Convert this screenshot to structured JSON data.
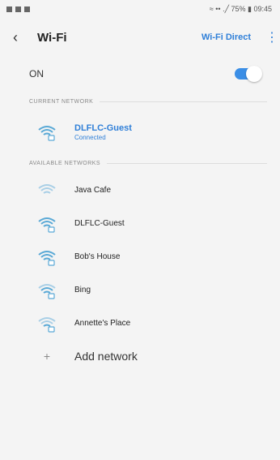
{
  "status_bar": {
    "right_text": "≈ •• .╱ 75% ▮ 09:45"
  },
  "header": {
    "back_icon": "chevron-left-icon",
    "title": "Wi-Fi",
    "wifi_direct": "Wi-Fi Direct",
    "more_icon": "more-vertical-icon"
  },
  "toggle": {
    "label": "ON",
    "state": "on",
    "accent": "#3a8ee6"
  },
  "current": {
    "section_label": "CURRENT NETWORK",
    "network": {
      "name": "DLFLC-Guest",
      "status": "Connected",
      "icon": "wifi-locked-icon"
    }
  },
  "available": {
    "section_label": "AVAILABLE NETWORKS",
    "networks": [
      {
        "name": "Java Cafe",
        "icon": "wifi-open-icon"
      },
      {
        "name": "DLFLC-Guest",
        "icon": "wifi-locked-icon"
      },
      {
        "name": "Bob's House",
        "icon": "wifi-locked-icon"
      },
      {
        "name": "Bing",
        "icon": "wifi-locked-icon"
      },
      {
        "name": "Annette's Place",
        "icon": "wifi-locked-icon"
      }
    ]
  },
  "add_network": {
    "label": "Add network",
    "icon": "plus-icon"
  },
  "colors": {
    "accent": "#2f7fd8",
    "wifi_icon": "#5aa9d6"
  }
}
